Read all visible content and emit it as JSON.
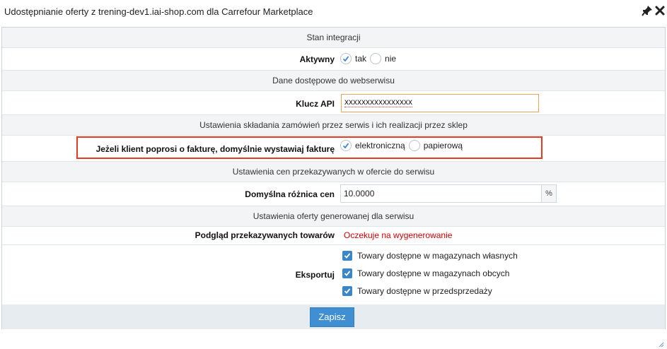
{
  "window": {
    "title": "Udostępnianie oferty z trening-dev1.iai-shop.com dla Carrefour Marketplace",
    "pin_icon": "pin-icon",
    "close_icon": "close-icon"
  },
  "sections": {
    "integration": "Stan integracji",
    "access": "Dane dostępowe do webserwisu",
    "orders": "Ustawienia składania zamówień przez serwis i ich realizacji przez sklep",
    "prices": "Ustawienia cen przekazywanych w ofercie do serwisu",
    "offer": "Ustawienia oferty generowanej dla serwisu"
  },
  "active": {
    "label": "Aktywny",
    "options": [
      "tak",
      "nie"
    ],
    "selected": "tak"
  },
  "api_key": {
    "label": "Klucz API",
    "value": "xxxxxxxxxxxxxxxx"
  },
  "invoice": {
    "label": "Jeżeli klient poprosi o fakturę, domyślnie wystawiaj fakturę",
    "options": [
      "elektroniczną",
      "papierową"
    ],
    "selected": "elektroniczną"
  },
  "price_diff": {
    "label": "Domyślna różnica cen",
    "value": "10.0000",
    "unit": "%"
  },
  "preview": {
    "label": "Podgląd przekazywanych towarów",
    "status": "Oczekuje na wygenerowanie"
  },
  "export": {
    "label": "Eksportuj",
    "items": [
      {
        "label": "Towary dostępne w magazynach własnych",
        "checked": true
      },
      {
        "label": "Towary dostępne w magazynach obcych",
        "checked": true
      },
      {
        "label": "Towary dostępne w przedsprzedaży",
        "checked": true
      }
    ]
  },
  "save_button": "Zapisz",
  "colors": {
    "accent": "#3f8fd2",
    "highlight": "#e53b1f",
    "warning": "#d00000",
    "section_bg": "#f2f4f6"
  }
}
